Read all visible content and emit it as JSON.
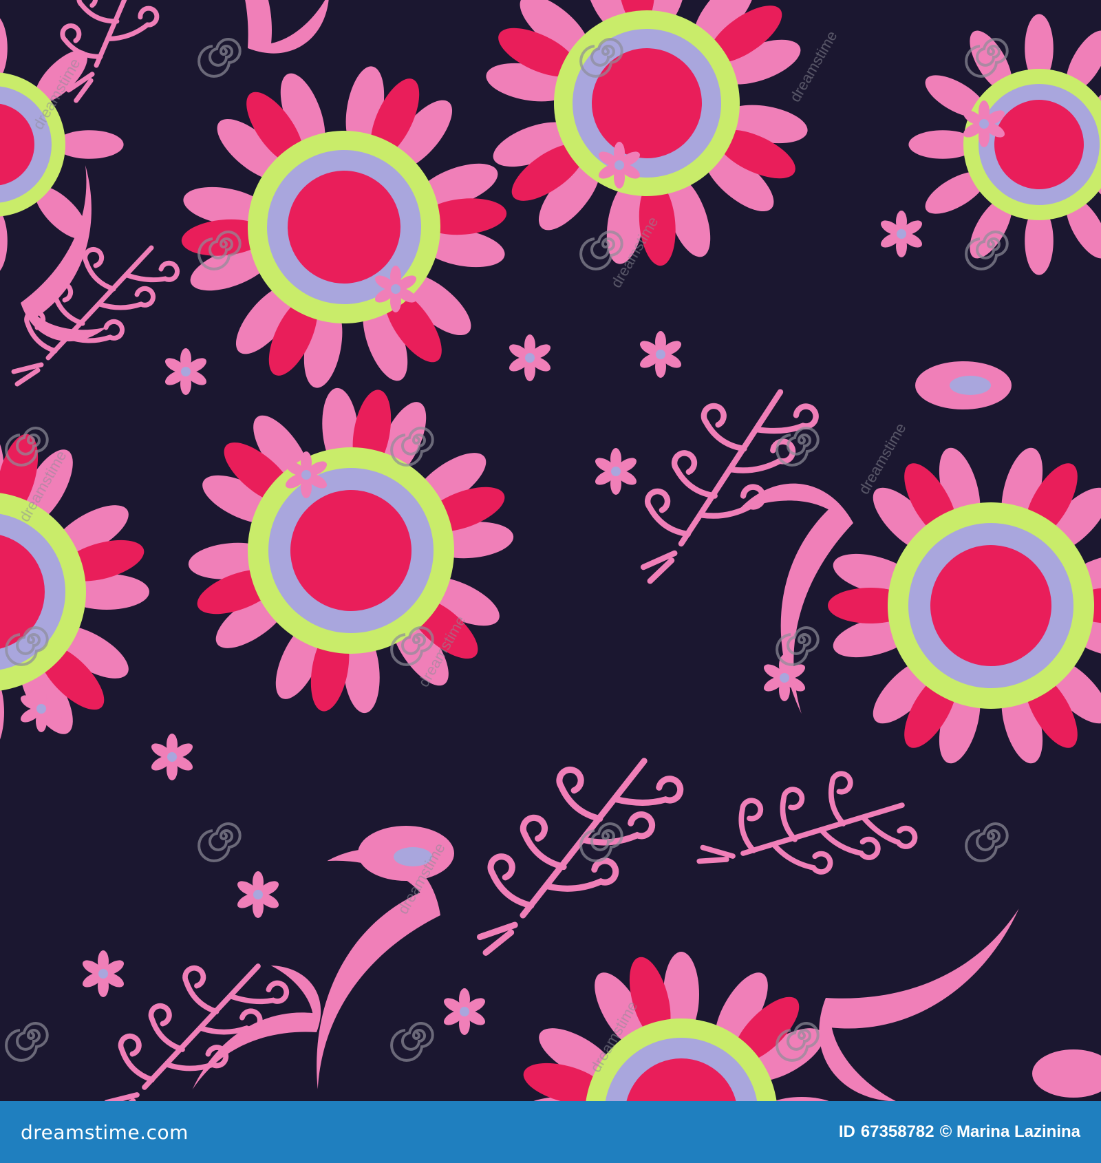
{
  "image": {
    "background_color": "#1b1730",
    "palette": {
      "pink": "#f07fb8",
      "magenta": "#e91e5a",
      "lilac": "#a9a6dd",
      "lime": "#c9ec6a",
      "watermark": "#7a7a86"
    },
    "motifs": [
      "suzani-flower",
      "spiral-branch",
      "feather-leaf",
      "small-star-flower",
      "spiral-watermark"
    ],
    "watermark_text": "dreamstime"
  },
  "footer": {
    "site": "dreamstime.com",
    "id_label": "ID",
    "id_value": "67358782",
    "copyright": "© Marina Lazinina"
  }
}
